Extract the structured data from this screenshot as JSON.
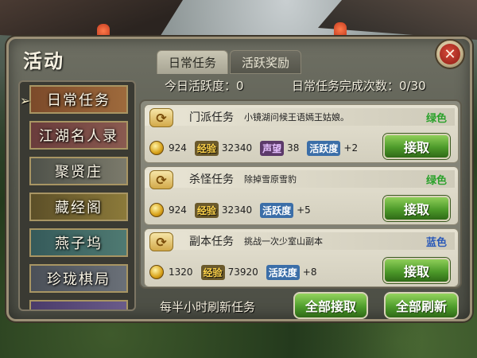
{
  "panel": {
    "title": "活动",
    "close_label": "✕"
  },
  "tabs": [
    {
      "label": "日常任务",
      "active": true
    },
    {
      "label": "活跃奖励",
      "active": false
    }
  ],
  "stats": {
    "activity_today": "今日活跃度：0",
    "daily_done": "日常任务完成次数：0/30"
  },
  "sidebar": {
    "active_marker": "➢",
    "items": [
      {
        "label": "日常任务",
        "active": true
      },
      {
        "label": "江湖名人录",
        "active": false
      },
      {
        "label": "聚贤庄",
        "active": false
      },
      {
        "label": "藏经阁",
        "active": false
      },
      {
        "label": "燕子坞",
        "active": false
      },
      {
        "label": "珍珑棋局",
        "active": false
      }
    ]
  },
  "tasks": [
    {
      "name": "门派任务",
      "desc": "小镜湖问候王语嫣王姑娘。",
      "color_label": "绿色",
      "color": "#2aa12a",
      "silver": "924",
      "exp_label": "经验",
      "exp": "32340",
      "rep_label": "声望",
      "rep": "38",
      "act_label": "活跃度",
      "act": "+2",
      "accept_label": "接取"
    },
    {
      "name": "杀怪任务",
      "desc": "除掉雪原雪豹",
      "color_label": "绿色",
      "color": "#2aa12a",
      "silver": "924",
      "exp_label": "经验",
      "exp": "32340",
      "act_label": "活跃度",
      "act": "+5",
      "accept_label": "接取"
    },
    {
      "name": "副本任务",
      "desc": "挑战一次少室山副本",
      "color_label": "蓝色",
      "color": "#2a59b8",
      "silver": "1320",
      "exp_label": "经验",
      "exp": "73920",
      "act_label": "活跃度",
      "act": "+8",
      "accept_label": "接取"
    }
  ],
  "footer": {
    "refresh_note": "每半小时刷新任务",
    "accept_all": "全部接取",
    "refresh_all": "全部刷新"
  }
}
